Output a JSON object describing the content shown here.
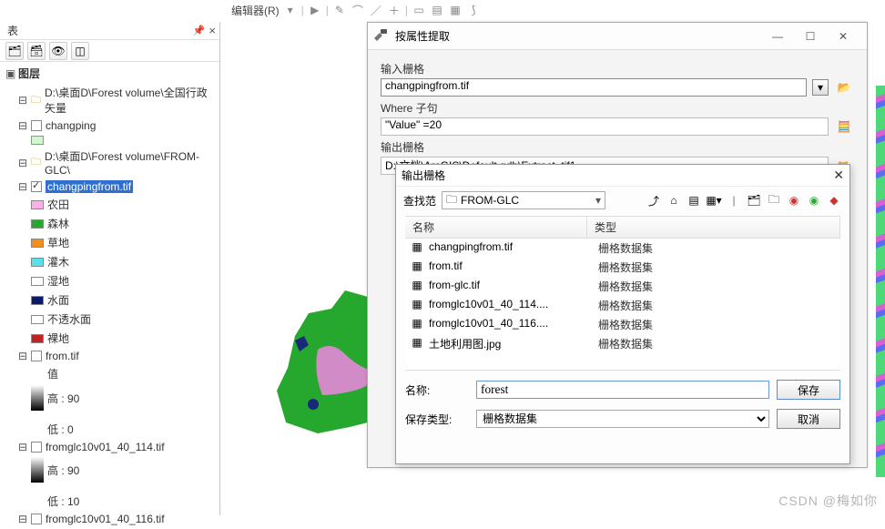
{
  "toolbar": {
    "editor_label": "编辑器(R)"
  },
  "toc": {
    "panel_title": "表",
    "section_label": "图层",
    "group1": "D:\\桌面D\\Forest volume\\全国行政矢量",
    "layer_changping": "changping",
    "group2": "D:\\桌面D\\Forest volume\\FROM-GLC\\",
    "layer_selected": "changpingfrom.tif",
    "legend": {
      "c0": "农田",
      "c1": "森林",
      "c2": "草地",
      "c3": "灌木",
      "c4": "湿地",
      "c5": "水面",
      "c6": "不透水面",
      "c7": "裸地"
    },
    "from_tif": {
      "name": "from.tif",
      "val_label": "值",
      "high": "高 : 90",
      "low": "低 : 0"
    },
    "fg114": {
      "name": "fromglc10v01_40_114.tif",
      "high": "高 : 90",
      "low": "低 : 10"
    },
    "fg116": {
      "name": "fromglc10v01_40_116.tif"
    }
  },
  "dialog": {
    "title": "按属性提取",
    "input_raster_label": "输入栅格",
    "input_raster_value": "changpingfrom.tif",
    "where_label": "Where 子句",
    "where_value": "\"Value\" =20",
    "output_raster_label": "输出栅格",
    "output_raster_value": "D:\\文档\\ArcGIS\\Default.gdb\\Extract_tif1"
  },
  "save": {
    "title": "输出栅格",
    "lookin_label": "查找范",
    "lookin_value": "FROM-GLC",
    "col_name": "名称",
    "col_type": "类型",
    "rows": [
      {
        "name": "changpingfrom.tif",
        "type": "栅格数据集"
      },
      {
        "name": "from.tif",
        "type": "栅格数据集"
      },
      {
        "name": "from-glc.tif",
        "type": "栅格数据集"
      },
      {
        "name": "fromglc10v01_40_114....",
        "type": "栅格数据集"
      },
      {
        "name": "fromglc10v01_40_116....",
        "type": "栅格数据集"
      },
      {
        "name": "土地利用图.jpg",
        "type": "栅格数据集"
      }
    ],
    "name_label": "名称:",
    "name_value": "forest",
    "type_label": "保存类型:",
    "type_value": "栅格数据集",
    "save_btn": "保存",
    "cancel_btn": "取消"
  },
  "watermark": "CSDN @梅如你"
}
